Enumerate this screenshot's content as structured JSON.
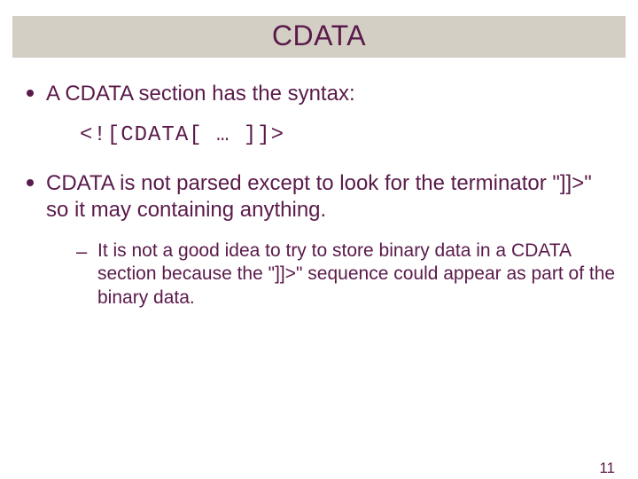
{
  "title": "CDATA",
  "bullets": [
    {
      "text": "A CDATA section has the syntax:",
      "code": "<![CDATA[ … ]]>"
    },
    {
      "text": "CDATA is not parsed except to look for the terminator \"]]>\" so it may containing anything.",
      "sub": "It is not a good idea to try to store binary data in a CDATA section because the \"]]>\" sequence could appear as part of the binary data."
    }
  ],
  "page_number": "11"
}
